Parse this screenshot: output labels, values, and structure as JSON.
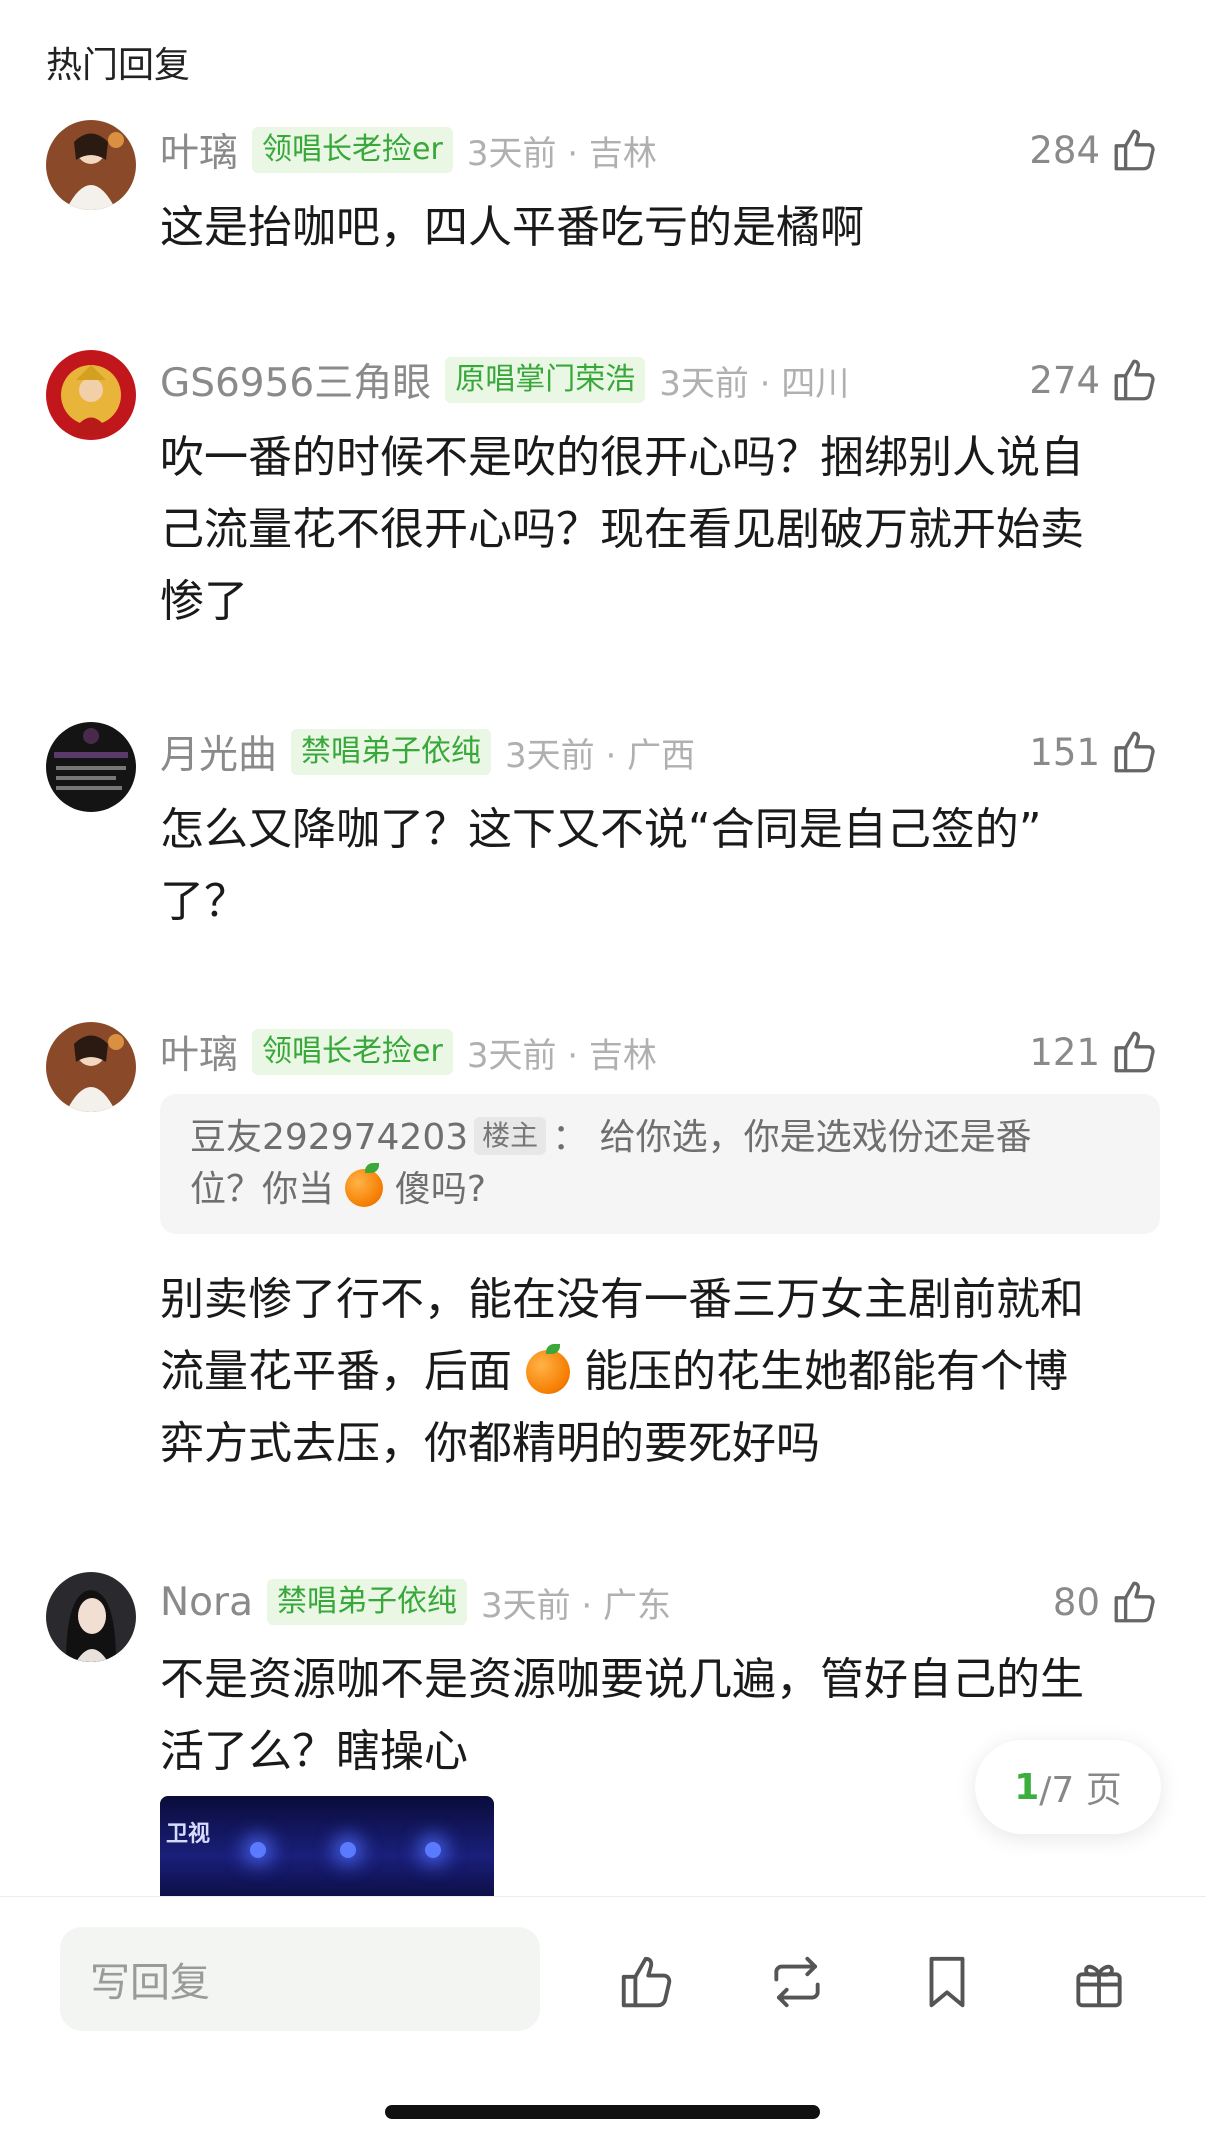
{
  "section_title": "热门回复",
  "comments": [
    {
      "username": "叶璃",
      "badge": "领唱长老捡er",
      "time_location": "3天前 · 吉林",
      "likes": "284",
      "text": "这是抬咖吧，四人平番吃亏的是橘啊"
    },
    {
      "username": "GS6956三角眼",
      "badge": "原唱掌门荣浩",
      "time_location": "3天前 · 四川",
      "likes": "274",
      "text_lines": [
        "吹一番的时候不是吹的很开心吗？捆绑别人说自",
        "己流量花不很开心吗？现在看见剧破万就开始卖",
        "惨了"
      ]
    },
    {
      "username": "月光曲",
      "badge": "禁唱弟子依纯",
      "time_location": "3天前 · 广西",
      "likes": "151",
      "text_lines": [
        "怎么又降咖了？这下又不说“合同是自己签的”",
        "了？"
      ]
    },
    {
      "username": "叶璃",
      "badge": "领唱长老捡er",
      "time_location": "3天前 · 吉林",
      "likes": "121",
      "quote": {
        "name": "豆友292974203",
        "host_label": "楼主",
        "sep": "：",
        "text_a": "给你选，你是选戏份还是番",
        "text_b1": "位？你当",
        "text_b2": "傻吗?"
      },
      "text_lines": [
        "别卖惨了行不，能在没有一番三万女主剧前就和",
        "流量花平番，后面",
        "能压的花生她都能有个博",
        "弈方式去压，你都精明的要死好吗"
      ]
    },
    {
      "username": "Nora",
      "badge": "禁唱弟子依纯",
      "time_location": "3天前 · 广东",
      "likes": "80",
      "text_lines": [
        "不是资源咖不是资源咖要说几遍，管好自己的生",
        "活了么？瞎操心"
      ],
      "image_caption": "卫视"
    }
  ],
  "pager": {
    "current": "1",
    "total_text": "/7 页"
  },
  "bottom_bar": {
    "reply_placeholder": "写回复",
    "icons": [
      "like-icon",
      "repost-icon",
      "bookmark-icon",
      "gift-icon"
    ]
  },
  "colors": {
    "accent_green": "#3bae3f",
    "badge_bg": "#eaf7e5",
    "meta_gray": "#8a8a8a"
  }
}
